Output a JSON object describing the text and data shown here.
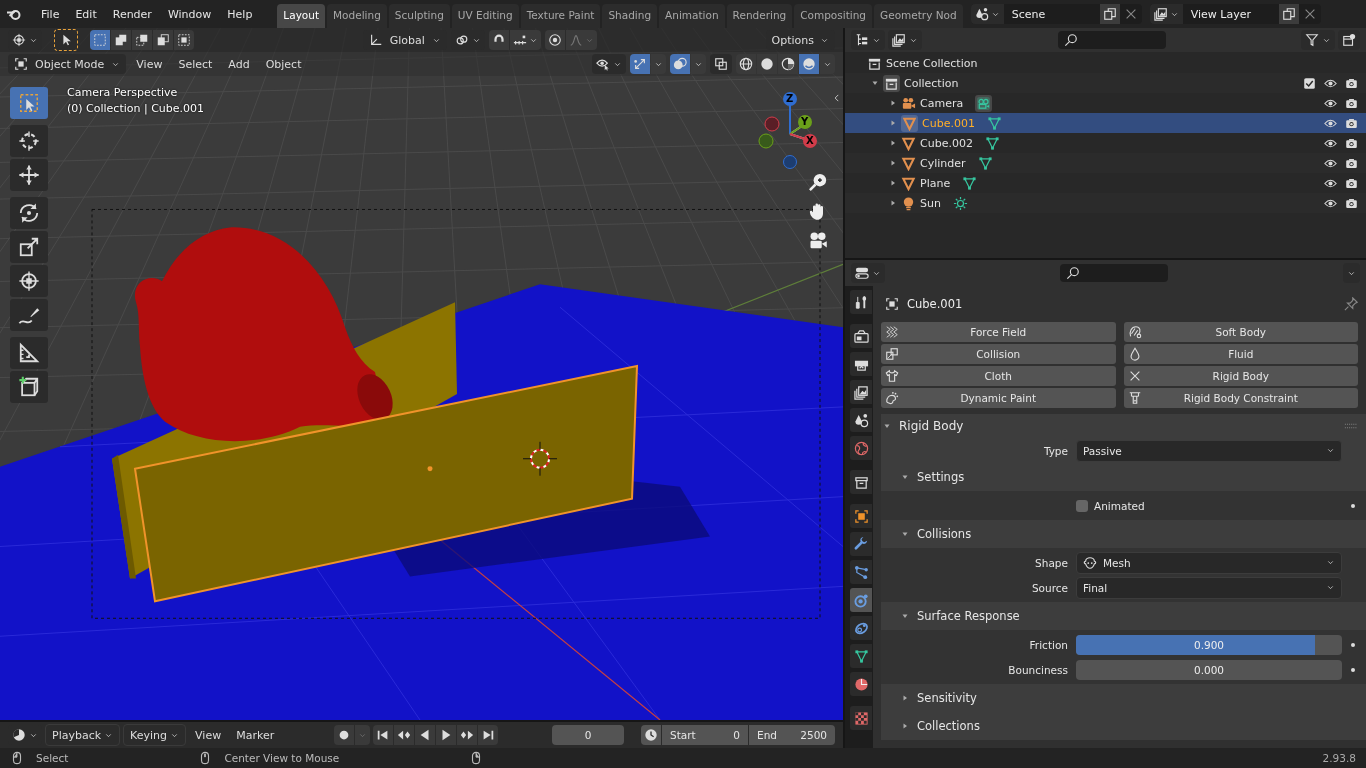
{
  "menu": [
    "File",
    "Edit",
    "Render",
    "Window",
    "Help"
  ],
  "workspaces": [
    {
      "label": "Layout",
      "selected": true
    },
    {
      "label": "Modeling",
      "selected": false
    },
    {
      "label": "Sculpting",
      "selected": false
    },
    {
      "label": "UV Editing",
      "selected": false
    },
    {
      "label": "Texture Paint",
      "selected": false
    },
    {
      "label": "Shading",
      "selected": false
    },
    {
      "label": "Animation",
      "selected": false
    },
    {
      "label": "Rendering",
      "selected": false
    },
    {
      "label": "Compositing",
      "selected": false
    },
    {
      "label": "Geometry Nod",
      "selected": false
    }
  ],
  "scene": "Scene",
  "view_layer": "View Layer",
  "viewport": {
    "select_modes": [
      {
        "selected": true
      },
      {
        "selected": false
      },
      {
        "selected": false
      },
      {
        "selected": false
      },
      {
        "selected": false
      }
    ],
    "transform_orientation": "Global",
    "snap": {
      "on": false
    },
    "proportional": {
      "on": false
    },
    "options": "Options",
    "mode": "Object Mode",
    "menus": [
      "View",
      "Select",
      "Add",
      "Object"
    ],
    "gizmos": {
      "on": true
    },
    "overlays": {
      "on": true
    },
    "xray": {
      "on": false
    },
    "shading_modes": [
      {
        "selected": false
      },
      {
        "selected": false
      },
      {
        "selected": false
      },
      {
        "selected": true
      }
    ],
    "camera_label": "Camera Perspective",
    "collection_label": "(0) Collection | Cube.001",
    "tools": [
      {
        "kind": "select",
        "selected": true
      },
      {
        "kind": "cursor",
        "selected": false
      },
      {
        "kind": "move",
        "selected": false
      },
      {
        "kind": "rotate",
        "selected": false
      },
      {
        "kind": "scale",
        "selected": false
      },
      {
        "kind": "transform",
        "selected": false
      },
      {
        "kind": "annotate",
        "selected": false
      },
      {
        "kind": "measure",
        "selected": false
      },
      {
        "kind": "add_cube",
        "selected": false
      }
    ],
    "gizmo_axes": [
      "Z",
      "Y",
      "X"
    ]
  },
  "outliner": {
    "root": "Scene Collection",
    "tree": [
      {
        "name": "Collection",
        "expanded": true,
        "checked": true,
        "children": [
          {
            "name": "Camera",
            "kind": "camera",
            "selected": false
          },
          {
            "name": "Cube.001",
            "kind": "mesh",
            "selected": true
          },
          {
            "name": "Cube.002",
            "kind": "mesh",
            "selected": false
          },
          {
            "name": "Cylinder",
            "kind": "mesh",
            "selected": false
          },
          {
            "name": "Plane",
            "kind": "mesh",
            "selected": false
          },
          {
            "name": "Sun",
            "kind": "light",
            "selected": false
          }
        ]
      }
    ]
  },
  "properties": {
    "tabs": [
      {
        "kind": "tool",
        "selected": false
      },
      {
        "kind": "render",
        "selected": false
      },
      {
        "kind": "output",
        "selected": false
      },
      {
        "kind": "view_layer",
        "selected": false
      },
      {
        "kind": "scene",
        "selected": false
      },
      {
        "kind": "world",
        "selected": false
      },
      {
        "kind": "collection",
        "selected": false
      },
      {
        "kind": "object",
        "selected": false
      },
      {
        "kind": "modifiers",
        "selected": false
      },
      {
        "kind": "particles",
        "selected": false
      },
      {
        "kind": "physics",
        "selected": true
      },
      {
        "kind": "constraints",
        "selected": false
      },
      {
        "kind": "data",
        "selected": false
      },
      {
        "kind": "material",
        "selected": false
      },
      {
        "kind": "texture",
        "selected": false
      }
    ],
    "object_name": "Cube.001",
    "physics_buttons": [
      {
        "label": "Force Field",
        "enabled": false
      },
      {
        "label": "Soft Body",
        "enabled": false
      },
      {
        "label": "Collision",
        "enabled": false
      },
      {
        "label": "Fluid",
        "enabled": false
      },
      {
        "label": "Cloth",
        "enabled": false
      },
      {
        "label": "Rigid Body",
        "enabled": true
      },
      {
        "label": "Dynamic Paint",
        "enabled": false
      },
      {
        "label": "Rigid Body Constraint",
        "enabled": false
      }
    ],
    "panel": {
      "title": "Rigid Body",
      "expanded": true,
      "fields": [
        {
          "kind": "dropdown",
          "label": "Type",
          "value": "Passive"
        }
      ],
      "subpanels": [
        {
          "title": "Settings",
          "expanded": true,
          "fields": [
            {
              "kind": "checkbox",
              "label": "Animated",
              "checked": false
            }
          ]
        },
        {
          "title": "Collisions",
          "expanded": true,
          "fields": [
            {
              "kind": "dropdown",
              "label": "Shape",
              "value": "Mesh",
              "icon": true
            },
            {
              "kind": "dropdown",
              "label": "Source",
              "value": "Final"
            }
          ]
        },
        {
          "title": "Surface Response",
          "expanded": true,
          "fields": [
            {
              "kind": "slider",
              "label": "Friction",
              "value": "0.900",
              "level": 0.9
            },
            {
              "kind": "slider",
              "label": "Bounciness",
              "value": "0.000",
              "level": 0
            }
          ]
        },
        {
          "title": "Sensitivity",
          "expanded": false
        },
        {
          "title": "Collections",
          "expanded": false
        }
      ]
    }
  },
  "timeline": {
    "menus": [
      {
        "label": "Playback",
        "dropdown": true
      },
      {
        "label": "Keying",
        "dropdown": true
      },
      {
        "label": "View",
        "dropdown": false
      },
      {
        "label": "Marker",
        "dropdown": false
      }
    ],
    "current_frame": "0",
    "start_label": "Start",
    "start": "0",
    "end_label": "End",
    "end": "2500"
  },
  "status_bar": {
    "hints": [
      "Select",
      "Center View to Mouse"
    ],
    "version": "2.93.8"
  }
}
